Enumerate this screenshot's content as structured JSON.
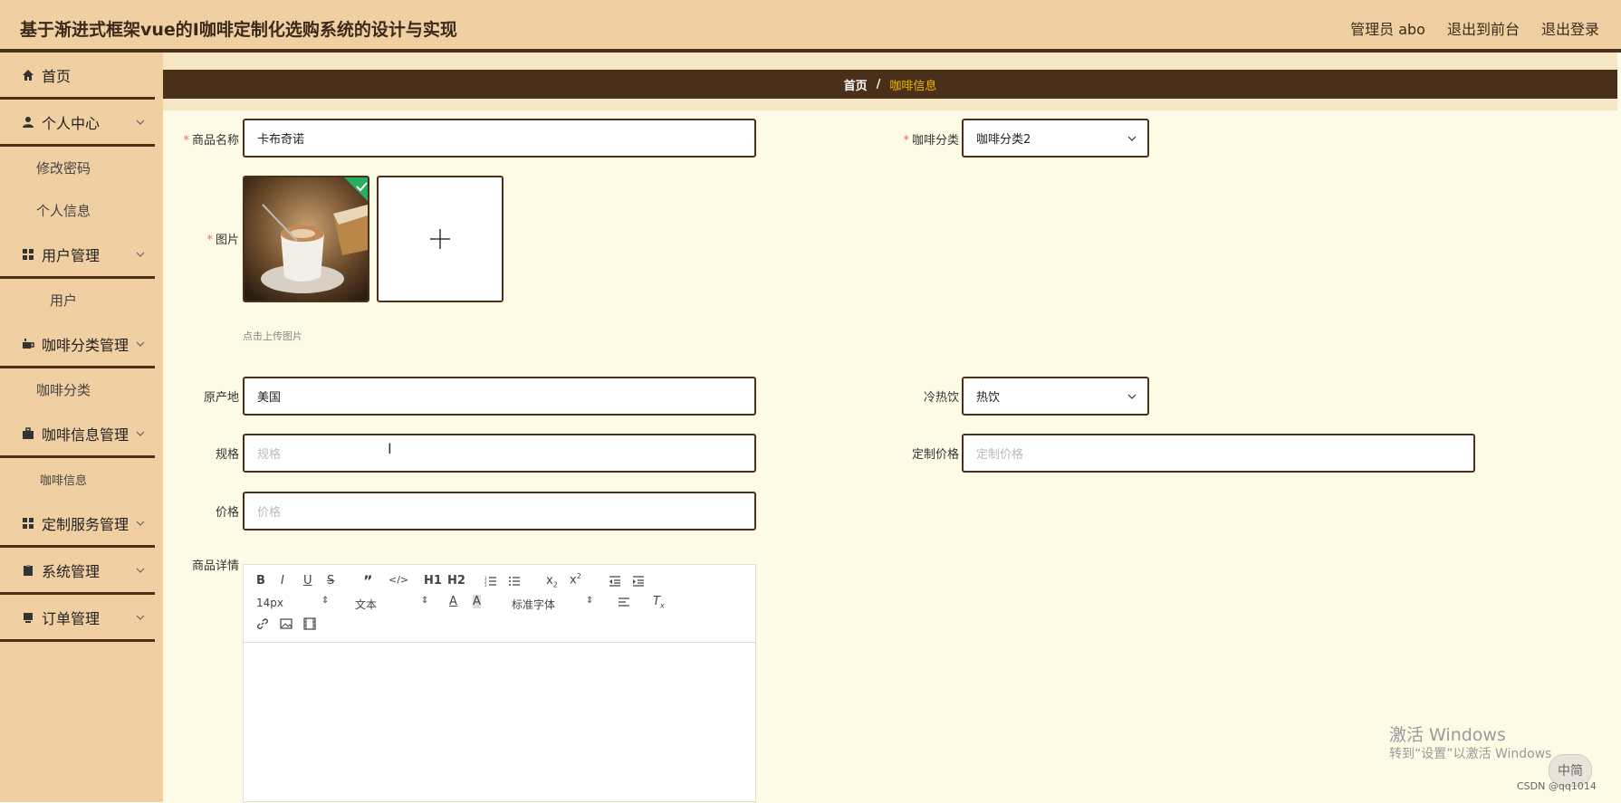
{
  "header": {
    "title": "基于渐进式框架vue的I咖啡定制化选购系统的设计与实现",
    "user": "管理员 abo",
    "front": "退出到前台",
    "logout": "退出登录"
  },
  "sidebar": {
    "home": "首页",
    "personal": "个人中心",
    "personal_sub": [
      "修改密码",
      "个人信息"
    ],
    "user_mgmt": "用户管理",
    "user_sub": [
      "用户"
    ],
    "category_mgmt": "咖啡分类管理",
    "category_sub": [
      "咖啡分类"
    ],
    "info_mgmt": "咖啡信息管理",
    "info_sub": [
      "咖啡信息"
    ],
    "custom_mgmt": "定制服务管理",
    "system_mgmt": "系统管理",
    "order_mgmt": "订单管理"
  },
  "breadcrumb": {
    "home": "首页",
    "sep": "/",
    "current": "咖啡信息"
  },
  "form": {
    "name_label": "商品名称",
    "name_value": "卡布奇诺",
    "category_label": "咖啡分类",
    "category_value": "咖啡分类2",
    "image_label": "图片",
    "upload_hint": "点击上传图片",
    "origin_label": "原产地",
    "origin_value": "美国",
    "temp_label": "冷热饮",
    "temp_value": "热饮",
    "spec_label": "规格",
    "spec_placeholder": "规格",
    "custom_price_label": "定制价格",
    "custom_price_placeholder": "定制价格",
    "price_label": "价格",
    "price_placeholder": "价格",
    "detail_label": "商品详情"
  },
  "editor": {
    "font_size": "14px",
    "paragraph": "文本",
    "font_family": "标准字体",
    "h1": "H1",
    "h2": "H2"
  },
  "overlay": {
    "activate_title": "激活 Windows",
    "activate_sub": "转到“设置”以激活 Windows",
    "csdn": "CSDN @qq1014",
    "ime": "中简"
  },
  "colors": {
    "header_bg": "#f0cfa2",
    "dark_brown": "#4a3018",
    "content_bg": "#fdfbe6",
    "breadcrumb_accent": "#f5b800"
  }
}
